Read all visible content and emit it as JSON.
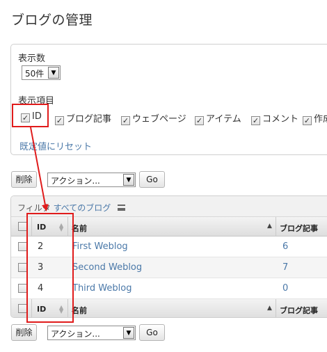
{
  "page": {
    "title": "ブログの管理"
  },
  "display_options": {
    "per_page_label": "表示数",
    "per_page_value": "50件",
    "columns_label": "表示項目",
    "columns": [
      {
        "label": "ID",
        "checked": true
      },
      {
        "label": "ブログ記事",
        "checked": true
      },
      {
        "label": "ウェブページ",
        "checked": true
      },
      {
        "label": "アイテム",
        "checked": true
      },
      {
        "label": "コメント",
        "checked": true
      },
      {
        "label": "作成",
        "checked": true
      }
    ],
    "reset_link": "既定値にリセット"
  },
  "actions": {
    "delete_label": "削除",
    "action_select": "アクション...",
    "go_label": "Go"
  },
  "filter": {
    "label": "フィルタ",
    "value": "すべてのブログ"
  },
  "table": {
    "headers": {
      "id": "ID",
      "name": "名前",
      "entries": "ブログ記事"
    },
    "rows": [
      {
        "id": "2",
        "name": "First Weblog",
        "entries": "6"
      },
      {
        "id": "3",
        "name": "Second Weblog",
        "entries": "7"
      },
      {
        "id": "4",
        "name": "Third Weblog",
        "entries": "0"
      }
    ]
  },
  "colors": {
    "link": "#4a78a8",
    "annotation": "#e01b1b"
  }
}
